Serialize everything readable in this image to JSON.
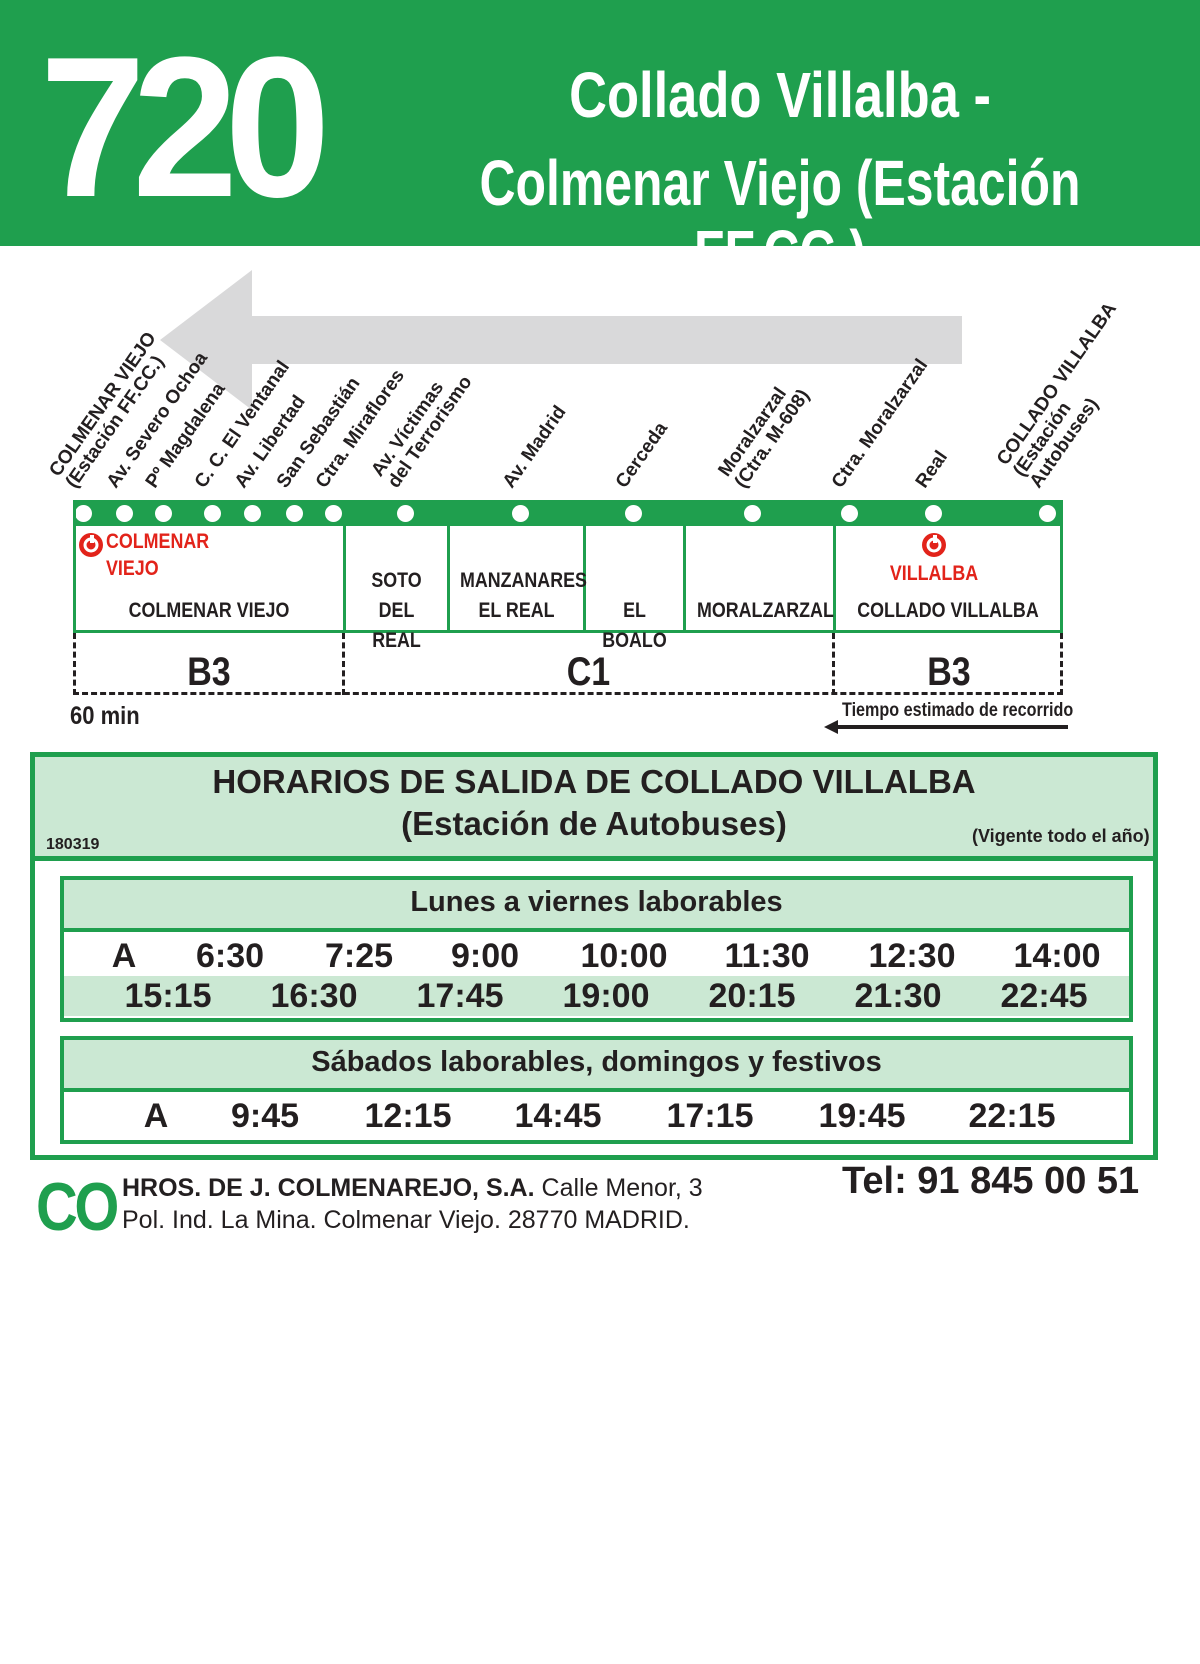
{
  "header": {
    "route_number": "720",
    "title_line1": "Collado Villalba -",
    "title_line2": "Colmenar Viejo (Estación FF.CC.)"
  },
  "stops": [
    [
      "COLMENAR VIEJO",
      "(Estación FF.CC.)"
    ],
    [
      "Av. Severo Ochoa"
    ],
    [
      "Pº Magdalena"
    ],
    [
      "C. C. El Ventanal"
    ],
    [
      "Av. Libertad"
    ],
    [
      "San Sebastián"
    ],
    [
      "Ctra. Miraflores"
    ],
    [
      "Av. Víctimas",
      "del Terrorismo"
    ],
    [
      "Av. Madrid"
    ],
    [
      "Cerceda"
    ],
    [
      "Moralzarzal",
      "(Ctra. M-608)"
    ],
    [
      "Ctra. Moralzarzal"
    ],
    [
      "Real"
    ],
    [
      "COLLADO VILLALBA",
      "(Estación",
      "Autobuses)"
    ]
  ],
  "towns": {
    "colmenar_rail_line1": "COLMENAR",
    "colmenar_rail_line2": "VIEJO",
    "colmenar": "COLMENAR VIEJO",
    "soto_line1": "SOTO DEL",
    "soto_line2": "REAL",
    "manzanares_line1": "MANZANARES",
    "manzanares_line2": "EL REAL",
    "boalo": "EL BOALO",
    "moralzarzal": "MORALZARZAL",
    "villalba_rail": "VILLALBA",
    "villalba": "COLLADO VILLALBA"
  },
  "zones": {
    "left": "B3",
    "middle": "C1",
    "right": "B3"
  },
  "travel_time": "60 min",
  "travel_time_label": "Tiempo estimado de recorrido",
  "colors": {
    "green": "#1f9f4e",
    "light_green": "#cbe8d3",
    "red": "#e2231a",
    "grey_arrow": "#d9d9da"
  },
  "schedule": {
    "title_line1": "HORARIOS DE SALIDA DE COLLADO VILLALBA",
    "title_line2": "(Estación de Autobuses)",
    "code": "180319",
    "validity": "(Vigente todo el año)",
    "weekdays": {
      "title": "Lunes a viernes laborables",
      "row1": [
        "A",
        "6:30",
        "7:25",
        "9:00",
        "10:00",
        "11:30",
        "12:30",
        "14:00"
      ],
      "row2": [
        "15:15",
        "16:30",
        "17:45",
        "19:00",
        "20:15",
        "21:30",
        "22:45"
      ]
    },
    "weekends": {
      "title": "Sábados laborables, domingos y festivos",
      "row1": [
        "A",
        "9:45",
        "12:15",
        "14:45",
        "17:15",
        "19:45",
        "22:15"
      ]
    }
  },
  "footer": {
    "logo": "CO",
    "company": "HROS. DE J. COLMENAREJO, S.A.",
    "address1": " Calle Menor, 3",
    "address2": "Pol. Ind. La Mina. Colmenar Viejo. 28770 MADRID.",
    "phone": "Tel: 91 845 00 51"
  }
}
